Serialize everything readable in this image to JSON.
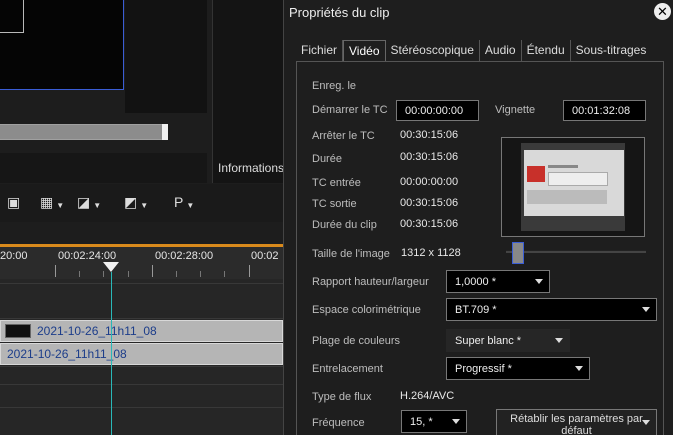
{
  "background": {
    "info_label": "Informations",
    "toolbar": [
      {
        "icon": "filter-icon",
        "glyph": "▣"
      },
      {
        "icon": "grid-icon",
        "glyph": "▦"
      },
      {
        "icon": "contrast-icon",
        "glyph": "◪"
      },
      {
        "icon": "color-correction-icon",
        "glyph": "◩"
      },
      {
        "icon": "p-icon",
        "glyph": "P"
      }
    ],
    "ruler_labels": [
      "20:00",
      "00:02:24:00",
      "00:02:28:00",
      "00:02"
    ],
    "clips": [
      "2021-10-26_11h11_08",
      "2021-10-26_11h11_08"
    ]
  },
  "dialog": {
    "title": "Propriétés du clip",
    "close_glyph": "✕",
    "tabs": [
      "Fichier",
      "Vidéo",
      "Stéréoscopique",
      "Audio",
      "Étendu",
      "Sous-titrages"
    ],
    "active_tab": "Vidéo",
    "fields": {
      "enreg_label": "Enreg. le",
      "start_tc_label": "Démarrer le TC",
      "start_tc_value": "00:00:00:00",
      "thumbnail_label": "Vignette",
      "thumbnail_value": "00:01:32:08",
      "stop_tc_label": "Arrêter le TC",
      "stop_tc_value": "00:30:15:06",
      "duration_label": "Durée",
      "duration_value": "00:30:15:06",
      "tc_in_label": "TC entrée",
      "tc_in_value": "00:00:00:00",
      "tc_out_label": "TC sortie",
      "tc_out_value": "00:30:15:06",
      "clip_duration_label": "Durée du clip",
      "clip_duration_value": "00:30:15:06",
      "image_size_label": "Taille de l'image",
      "image_size_value": "1312 x 1128",
      "aspect_label": "Rapport hauteur/largeur",
      "aspect_value": "1,0000 *",
      "colorspace_label": "Espace colorimétrique",
      "colorspace_value": "BT.709 *",
      "color_range_label": "Plage de couleurs",
      "color_range_value": "Super blanc *",
      "interlace_label": "Entrelacement",
      "interlace_value": "Progressif *",
      "stream_type_label": "Type de flux",
      "stream_type_value": "H.264/AVC",
      "frequency_label": "Fréquence",
      "frequency_value": "15, *",
      "reset_button": "Rétablir les paramètres par défaut"
    }
  },
  "colors": {
    "accent_blue": "#3a5dd6",
    "playhead": "#29b8b8",
    "ruler_accent": "#d98a1c",
    "clip_text": "#1c3d8a"
  }
}
